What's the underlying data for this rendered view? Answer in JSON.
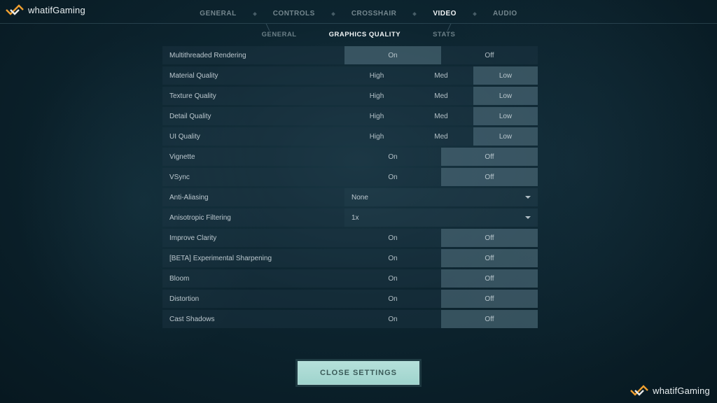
{
  "brand": "whatifGaming",
  "topNav": {
    "tabs": [
      "GENERAL",
      "CONTROLS",
      "CROSSHAIR",
      "VIDEO",
      "AUDIO"
    ],
    "activeIndex": 3
  },
  "subNav": {
    "tabs": [
      "GENERAL",
      "GRAPHICS QUALITY",
      "STATS"
    ],
    "activeIndex": 1
  },
  "settings": [
    {
      "label": "Multithreaded Rendering",
      "type": "toggle2",
      "options": [
        "On",
        "Off"
      ],
      "selected": 0
    },
    {
      "label": "Material Quality",
      "type": "toggle3",
      "options": [
        "High",
        "Med",
        "Low"
      ],
      "selected": 2
    },
    {
      "label": "Texture Quality",
      "type": "toggle3",
      "options": [
        "High",
        "Med",
        "Low"
      ],
      "selected": 2
    },
    {
      "label": "Detail Quality",
      "type": "toggle3",
      "options": [
        "High",
        "Med",
        "Low"
      ],
      "selected": 2
    },
    {
      "label": "UI Quality",
      "type": "toggle3",
      "options": [
        "High",
        "Med",
        "Low"
      ],
      "selected": 2
    },
    {
      "label": "Vignette",
      "type": "toggle2",
      "options": [
        "On",
        "Off"
      ],
      "selected": 1
    },
    {
      "label": "VSync",
      "type": "toggle2",
      "options": [
        "On",
        "Off"
      ],
      "selected": 1
    },
    {
      "label": "Anti-Aliasing",
      "type": "dropdown",
      "value": "None"
    },
    {
      "label": "Anisotropic Filtering",
      "type": "dropdown",
      "value": "1x"
    },
    {
      "label": "Improve Clarity",
      "type": "toggle2",
      "options": [
        "On",
        "Off"
      ],
      "selected": 1
    },
    {
      "label": "[BETA] Experimental Sharpening",
      "type": "toggle2",
      "options": [
        "On",
        "Off"
      ],
      "selected": 1
    },
    {
      "label": "Bloom",
      "type": "toggle2",
      "options": [
        "On",
        "Off"
      ],
      "selected": 1
    },
    {
      "label": "Distortion",
      "type": "toggle2",
      "options": [
        "On",
        "Off"
      ],
      "selected": 1
    },
    {
      "label": "Cast Shadows",
      "type": "toggle2",
      "options": [
        "On",
        "Off"
      ],
      "selected": 1
    }
  ],
  "closeButton": "CLOSE SETTINGS",
  "colors": {
    "accent": "#a7dcd4",
    "rowBg": "#1e3744"
  }
}
